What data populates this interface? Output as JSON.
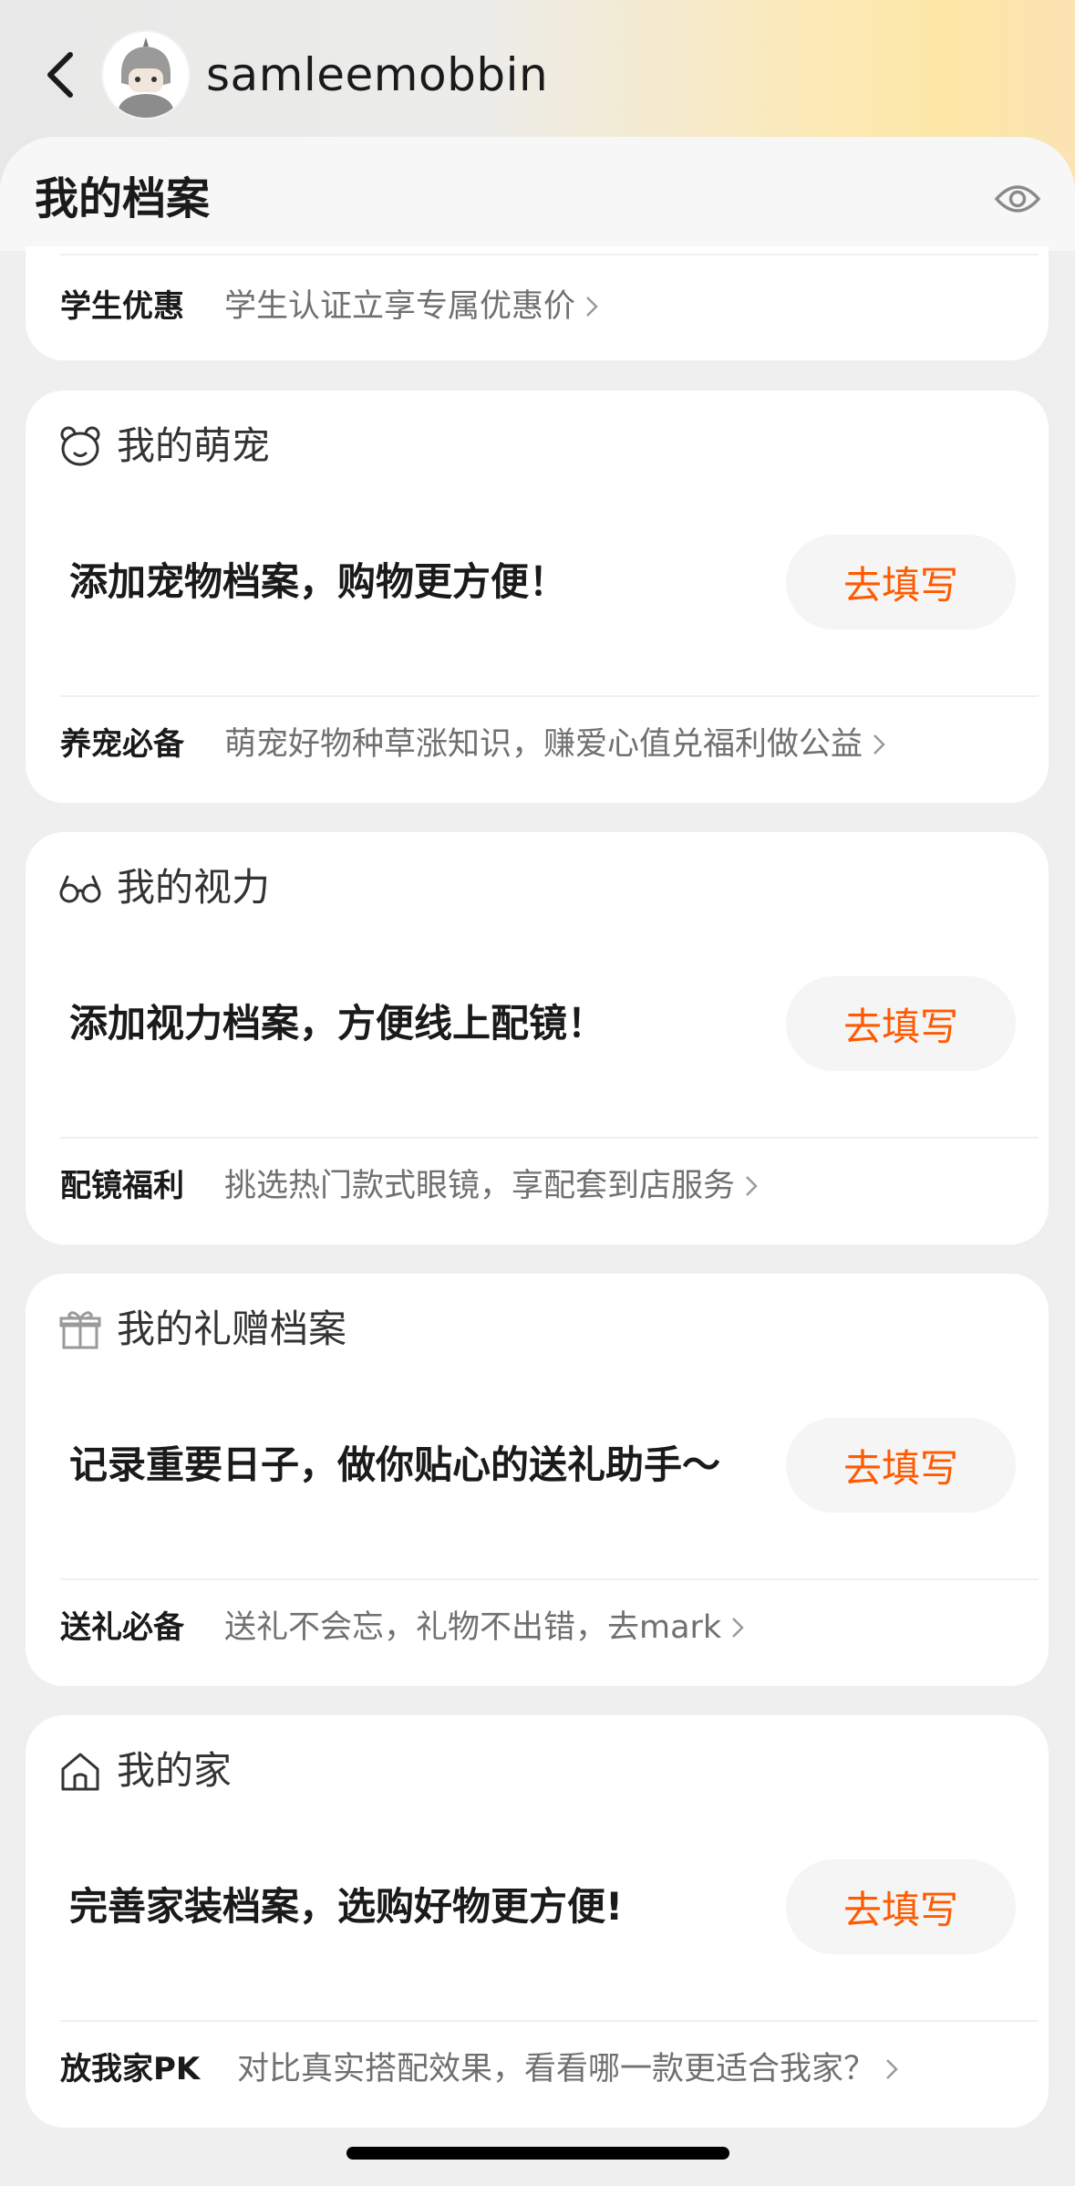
{
  "header": {
    "username": "samleemobbin",
    "page_title": "我的档案"
  },
  "student": {
    "label": "学生优惠",
    "desc": "学生认证立享专属优惠价"
  },
  "cards": [
    {
      "title": "我的萌宠",
      "icon": "bear-icon",
      "prompt": "添加宠物档案，购物更方便！",
      "button": "去填写",
      "footer_label": "养宠必备",
      "footer_desc": "萌宠好物种草涨知识，赚爱心值兑福利做公益"
    },
    {
      "title": "我的视力",
      "icon": "glasses-icon",
      "prompt": "添加视力档案，方便线上配镜！",
      "button": "去填写",
      "footer_label": "配镜福利",
      "footer_desc": "挑选热门款式眼镜，享配套到店服务"
    },
    {
      "title": "我的礼赠档案",
      "icon": "gift-icon",
      "prompt": "记录重要日子，做你贴心的送礼助手～",
      "button": "去填写",
      "footer_label": "送礼必备",
      "footer_desc": "送礼不会忘，礼物不出错，去mark"
    },
    {
      "title": "我的家",
      "icon": "home-icon",
      "prompt": "完善家装档案，选购好物更方便!",
      "button": "去填写",
      "footer_label": "放我家PK",
      "footer_desc": "对比真实搭配效果，看看哪一款更适合我家？"
    }
  ],
  "colors": {
    "accent": "#ff5a00",
    "card_bg": "#ffffff",
    "page_bg": "#efefef"
  }
}
